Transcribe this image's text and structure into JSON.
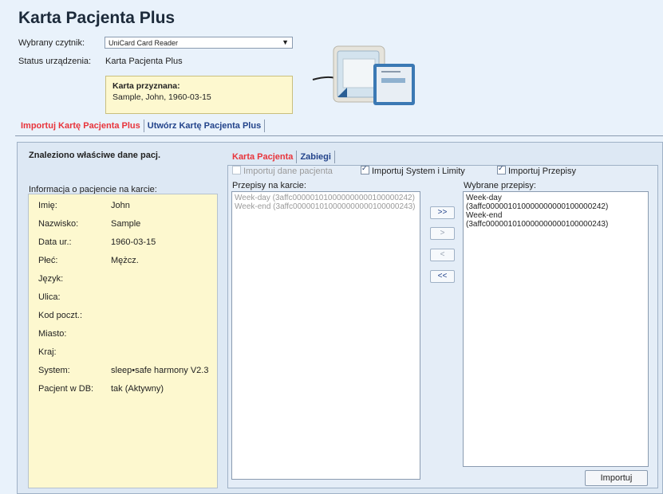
{
  "app": {
    "title": "Karta Pacjenta Plus"
  },
  "reader": {
    "label": "Wybrany czytnik:",
    "value": "UniCard Card Reader"
  },
  "device_status": {
    "label": "Status urządzenia:",
    "value": "Karta Pacjenta Plus"
  },
  "assigned_card": {
    "heading": "Karta przyznana:",
    "text": "Sample, John, 1960-03-15"
  },
  "main_tabs": [
    {
      "label": "Importuj Kartę Pacjenta Plus",
      "active": true
    },
    {
      "label": "Utwórz Kartę Pacjenta Plus",
      "active": false
    }
  ],
  "left": {
    "found_text": "Znaleziono właściwe dane pacj.",
    "info_label": "Informacja o pacjencie na karcie:",
    "fields": [
      {
        "key": "Imię:",
        "value": "John"
      },
      {
        "key": "Nazwisko:",
        "value": "Sample"
      },
      {
        "key": "Data ur.:",
        "value": "1960-03-15"
      },
      {
        "key": "Płeć:",
        "value": "Mężcz."
      },
      {
        "key": "Język:",
        "value": ""
      },
      {
        "key": "Ulica:",
        "value": ""
      },
      {
        "key": "Kod poczt.:",
        "value": ""
      },
      {
        "key": "Miasto:",
        "value": ""
      },
      {
        "key": "Kraj:",
        "value": ""
      },
      {
        "key": "System:",
        "value": "sleep•safe harmony V2.3"
      },
      {
        "key": "Pacjent w DB:",
        "value": "tak (Aktywny)"
      }
    ]
  },
  "sub_tabs": [
    {
      "label": "Karta Pacjenta",
      "active": true
    },
    {
      "label": "Zabiegi",
      "active": false
    }
  ],
  "options": {
    "import_patient": {
      "label": "Importuj dane pacjenta",
      "checked": false,
      "disabled": true
    },
    "import_system": {
      "label": "Importuj System i Limity",
      "checked": true
    },
    "import_prescriptions": {
      "label": "Importuj Przepisy",
      "checked": true
    }
  },
  "card_prescriptions": {
    "label": "Przepisy na karcie:",
    "items": [
      "Week-day (3affc000001010000000000100000242)",
      "Week-end (3affc000001010000000000100000243)"
    ]
  },
  "selected_prescriptions": {
    "label": "Wybrane przepisy:",
    "items": [
      "Week-day (3affc000001010000000000100000242)",
      "Week-end (3affc000001010000000000100000243)"
    ]
  },
  "move_buttons": {
    "all_right": ">>",
    "right": ">",
    "left": "<",
    "all_left": "<<"
  },
  "import_button": "Importuj",
  "colors": {
    "active_tab": "#e8343b",
    "inactive_tab": "#23448b",
    "background": "#e9f2fb",
    "info_bg": "#fdf8cf"
  }
}
